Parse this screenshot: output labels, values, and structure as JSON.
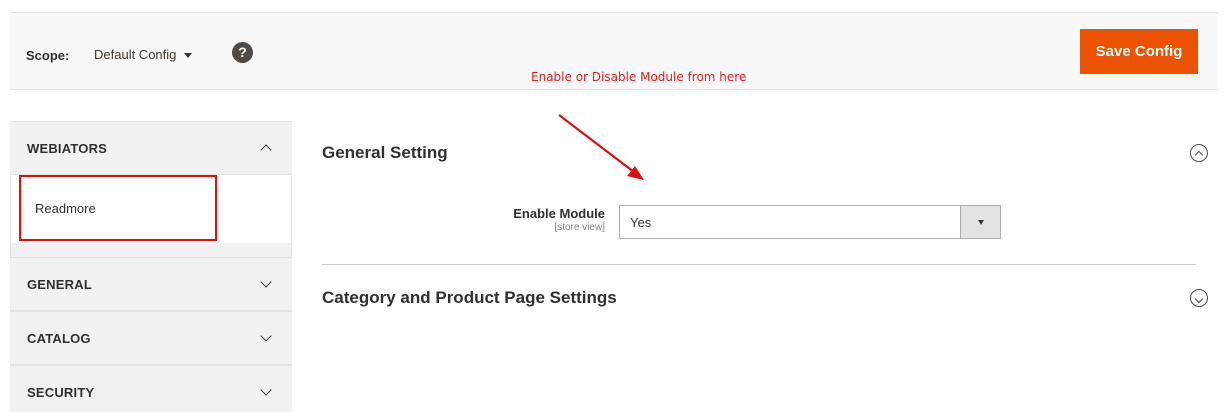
{
  "scope": {
    "label": "Scope:",
    "value": "Default Config",
    "help_symbol": "?"
  },
  "toolbar": {
    "save_label": "Save Config",
    "accent_color": "#eb5202"
  },
  "annotation": {
    "text": "Enable or Disable Module from here",
    "color": "#e02020"
  },
  "sidebar": {
    "tabs": [
      {
        "label": "WEBIATORS",
        "expanded": true,
        "items": [
          {
            "label": "Readmore",
            "highlighted": true
          }
        ]
      },
      {
        "label": "GENERAL",
        "expanded": false
      },
      {
        "label": "CATALOG",
        "expanded": false
      },
      {
        "label": "SECURITY",
        "expanded": false
      }
    ]
  },
  "main": {
    "sections": [
      {
        "title": "General Setting",
        "expanded": true,
        "fields": [
          {
            "label": "Enable Module",
            "scope": "[store view]",
            "value": "Yes"
          }
        ]
      },
      {
        "title": "Category and Product Page Settings",
        "expanded": false
      }
    ]
  }
}
